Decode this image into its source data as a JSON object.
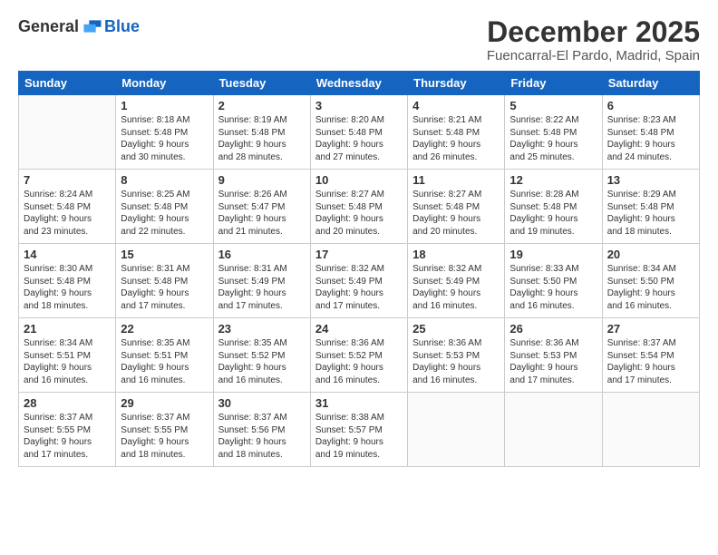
{
  "header": {
    "logo_general": "General",
    "logo_blue": "Blue",
    "title": "December 2025",
    "subtitle": "Fuencarral-El Pardo, Madrid, Spain"
  },
  "days_of_week": [
    "Sunday",
    "Monday",
    "Tuesday",
    "Wednesday",
    "Thursday",
    "Friday",
    "Saturday"
  ],
  "weeks": [
    [
      {
        "day": "",
        "info": ""
      },
      {
        "day": "1",
        "info": "Sunrise: 8:18 AM\nSunset: 5:48 PM\nDaylight: 9 hours\nand 30 minutes."
      },
      {
        "day": "2",
        "info": "Sunrise: 8:19 AM\nSunset: 5:48 PM\nDaylight: 9 hours\nand 28 minutes."
      },
      {
        "day": "3",
        "info": "Sunrise: 8:20 AM\nSunset: 5:48 PM\nDaylight: 9 hours\nand 27 minutes."
      },
      {
        "day": "4",
        "info": "Sunrise: 8:21 AM\nSunset: 5:48 PM\nDaylight: 9 hours\nand 26 minutes."
      },
      {
        "day": "5",
        "info": "Sunrise: 8:22 AM\nSunset: 5:48 PM\nDaylight: 9 hours\nand 25 minutes."
      },
      {
        "day": "6",
        "info": "Sunrise: 8:23 AM\nSunset: 5:48 PM\nDaylight: 9 hours\nand 24 minutes."
      }
    ],
    [
      {
        "day": "7",
        "info": "Sunrise: 8:24 AM\nSunset: 5:48 PM\nDaylight: 9 hours\nand 23 minutes."
      },
      {
        "day": "8",
        "info": "Sunrise: 8:25 AM\nSunset: 5:48 PM\nDaylight: 9 hours\nand 22 minutes."
      },
      {
        "day": "9",
        "info": "Sunrise: 8:26 AM\nSunset: 5:47 PM\nDaylight: 9 hours\nand 21 minutes."
      },
      {
        "day": "10",
        "info": "Sunrise: 8:27 AM\nSunset: 5:48 PM\nDaylight: 9 hours\nand 20 minutes."
      },
      {
        "day": "11",
        "info": "Sunrise: 8:27 AM\nSunset: 5:48 PM\nDaylight: 9 hours\nand 20 minutes."
      },
      {
        "day": "12",
        "info": "Sunrise: 8:28 AM\nSunset: 5:48 PM\nDaylight: 9 hours\nand 19 minutes."
      },
      {
        "day": "13",
        "info": "Sunrise: 8:29 AM\nSunset: 5:48 PM\nDaylight: 9 hours\nand 18 minutes."
      }
    ],
    [
      {
        "day": "14",
        "info": "Sunrise: 8:30 AM\nSunset: 5:48 PM\nDaylight: 9 hours\nand 18 minutes."
      },
      {
        "day": "15",
        "info": "Sunrise: 8:31 AM\nSunset: 5:48 PM\nDaylight: 9 hours\nand 17 minutes."
      },
      {
        "day": "16",
        "info": "Sunrise: 8:31 AM\nSunset: 5:49 PM\nDaylight: 9 hours\nand 17 minutes."
      },
      {
        "day": "17",
        "info": "Sunrise: 8:32 AM\nSunset: 5:49 PM\nDaylight: 9 hours\nand 17 minutes."
      },
      {
        "day": "18",
        "info": "Sunrise: 8:32 AM\nSunset: 5:49 PM\nDaylight: 9 hours\nand 16 minutes."
      },
      {
        "day": "19",
        "info": "Sunrise: 8:33 AM\nSunset: 5:50 PM\nDaylight: 9 hours\nand 16 minutes."
      },
      {
        "day": "20",
        "info": "Sunrise: 8:34 AM\nSunset: 5:50 PM\nDaylight: 9 hours\nand 16 minutes."
      }
    ],
    [
      {
        "day": "21",
        "info": "Sunrise: 8:34 AM\nSunset: 5:51 PM\nDaylight: 9 hours\nand 16 minutes."
      },
      {
        "day": "22",
        "info": "Sunrise: 8:35 AM\nSunset: 5:51 PM\nDaylight: 9 hours\nand 16 minutes."
      },
      {
        "day": "23",
        "info": "Sunrise: 8:35 AM\nSunset: 5:52 PM\nDaylight: 9 hours\nand 16 minutes."
      },
      {
        "day": "24",
        "info": "Sunrise: 8:36 AM\nSunset: 5:52 PM\nDaylight: 9 hours\nand 16 minutes."
      },
      {
        "day": "25",
        "info": "Sunrise: 8:36 AM\nSunset: 5:53 PM\nDaylight: 9 hours\nand 16 minutes."
      },
      {
        "day": "26",
        "info": "Sunrise: 8:36 AM\nSunset: 5:53 PM\nDaylight: 9 hours\nand 17 minutes."
      },
      {
        "day": "27",
        "info": "Sunrise: 8:37 AM\nSunset: 5:54 PM\nDaylight: 9 hours\nand 17 minutes."
      }
    ],
    [
      {
        "day": "28",
        "info": "Sunrise: 8:37 AM\nSunset: 5:55 PM\nDaylight: 9 hours\nand 17 minutes."
      },
      {
        "day": "29",
        "info": "Sunrise: 8:37 AM\nSunset: 5:55 PM\nDaylight: 9 hours\nand 18 minutes."
      },
      {
        "day": "30",
        "info": "Sunrise: 8:37 AM\nSunset: 5:56 PM\nDaylight: 9 hours\nand 18 minutes."
      },
      {
        "day": "31",
        "info": "Sunrise: 8:38 AM\nSunset: 5:57 PM\nDaylight: 9 hours\nand 19 minutes."
      },
      {
        "day": "",
        "info": ""
      },
      {
        "day": "",
        "info": ""
      },
      {
        "day": "",
        "info": ""
      }
    ]
  ]
}
